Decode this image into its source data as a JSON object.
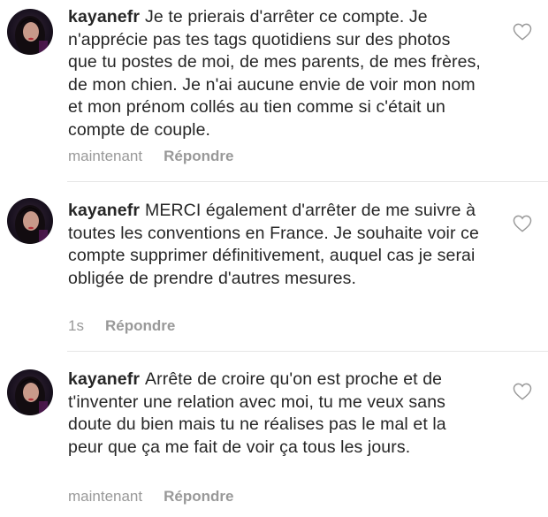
{
  "comments": [
    {
      "username": "kayanefr",
      "text": "Je te prierais d'arrêter ce compte. Je n'apprécie pas tes tags quotidiens sur des photos que tu postes de moi, de mes parents, de mes frères, de mon chien. Je n'ai aucune envie de voir mon nom et mon prénom collés au tien comme si c'était un compte de couple.",
      "time": "maintenant",
      "reply_label": "Répondre",
      "like_icon": "heart-outline-icon"
    },
    {
      "username": "kayanefr",
      "text": "MERCI également d'arrêter de me suivre à toutes les conventions en France. Je souhaite voir ce compte supprimer définitivement, auquel cas je serai obligée de prendre d'autres mesures.",
      "time": "1s",
      "reply_label": "Répondre",
      "like_icon": "heart-outline-icon"
    },
    {
      "username": "kayanefr",
      "text": "Arrête de croire qu'on est proche et de t'inventer une relation avec moi, tu me veux sans doute du bien mais tu ne réalises pas le mal et la peur que ça me fait de voir ça tous les jours.",
      "time": "maintenant",
      "reply_label": "Répondre",
      "like_icon": "heart-outline-icon"
    }
  ]
}
